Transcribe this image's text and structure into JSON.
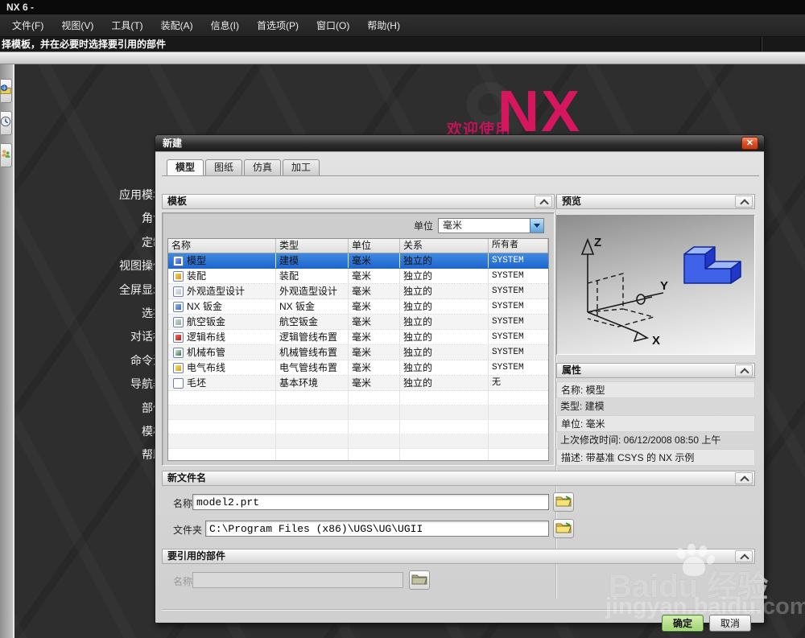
{
  "window": {
    "title": "NX 6 -",
    "prompt": "择模板，并在必要时选择要引用的部件"
  },
  "menubar": {
    "items": [
      "文件(F)",
      "视图(V)",
      "工具(T)",
      "装配(A)",
      "信息(I)",
      "首选项(P)",
      "窗口(O)",
      "帮助(H)"
    ]
  },
  "welcome": {
    "small_text": "欢迎使用",
    "big_text": "NX",
    "accent_color": "#d6175f"
  },
  "sidebar": {
    "items": [
      "应用模块",
      "角色",
      "定制",
      "视图操作",
      "全屏显示",
      "选择",
      "对话框",
      "命令流",
      "导航器",
      "部件",
      "模板",
      "帮助"
    ]
  },
  "resource_bar": {
    "icons": [
      "history-palette-icon",
      "clock-icon",
      "roles-icon"
    ]
  },
  "dialog": {
    "title": "新建",
    "close_label": "✕",
    "tabs": [
      "模型",
      "图纸",
      "仿真",
      "加工"
    ],
    "active_tab": "模型",
    "template_section": {
      "title": "模板",
      "units_label": "单位",
      "units_value": "毫米"
    },
    "table": {
      "headers": [
        "名称",
        "类型",
        "单位",
        "关系",
        "所有者"
      ],
      "rows": [
        {
          "name": "模型",
          "type": "建模",
          "units": "毫米",
          "relationship": "独立的",
          "owner": "SYSTEM",
          "selected": true,
          "icon": "model-icon"
        },
        {
          "name": "装配",
          "type": "装配",
          "units": "毫米",
          "relationship": "独立的",
          "owner": "SYSTEM",
          "selected": false,
          "icon": "assembly-icon"
        },
        {
          "name": "外观造型设计",
          "type": "外观造型设计",
          "units": "毫米",
          "relationship": "独立的",
          "owner": "SYSTEM",
          "selected": false,
          "icon": "shape-studio-icon"
        },
        {
          "name": "NX 钣金",
          "type": "NX 钣金",
          "units": "毫米",
          "relationship": "独立的",
          "owner": "SYSTEM",
          "selected": false,
          "icon": "sheet-metal-icon"
        },
        {
          "name": "航空钣金",
          "type": "航空钣金",
          "units": "毫米",
          "relationship": "独立的",
          "owner": "SYSTEM",
          "selected": false,
          "icon": "aero-sheet-metal-icon"
        },
        {
          "name": "逻辑布线",
          "type": "逻辑管线布置",
          "units": "毫米",
          "relationship": "独立的",
          "owner": "SYSTEM",
          "selected": false,
          "icon": "logical-routing-icon"
        },
        {
          "name": "机械布管",
          "type": "机械管线布置",
          "units": "毫米",
          "relationship": "独立的",
          "owner": "SYSTEM",
          "selected": false,
          "icon": "mechanical-routing-icon"
        },
        {
          "name": "电气布线",
          "type": "电气管线布置",
          "units": "毫米",
          "relationship": "独立的",
          "owner": "SYSTEM",
          "selected": false,
          "icon": "electrical-routing-icon"
        },
        {
          "name": "毛坯",
          "type": "基本环境",
          "units": "毫米",
          "relationship": "独立的",
          "owner": "无",
          "selected": false,
          "icon": "blank-icon"
        }
      ]
    },
    "preview_section": {
      "title": "预览",
      "axis_labels": {
        "x": "X",
        "y": "Y",
        "z": "Z"
      }
    },
    "properties_section": {
      "title": "属性",
      "rows": [
        "名称: 模型",
        "类型: 建模",
        "单位: 毫米",
        "上次修改时间: 06/12/2008 08:50 上午",
        "描述: 带基准 CSYS 的 NX 示例"
      ]
    },
    "new_file_section": {
      "title": "新文件名",
      "name_label": "名称",
      "name_value": "model2.prt",
      "folder_label": "文件夹",
      "folder_value": "C:\\Program Files (x86)\\UGS\\UG\\UGII"
    },
    "reference_section": {
      "title": "要引用的部件",
      "name_label": "名称",
      "name_value": ""
    },
    "buttons": {
      "ok": "确定",
      "cancel": "取消"
    }
  },
  "watermark": {
    "brand_left": "Bai",
    "brand_right": "du",
    "brand_suffix": "经验",
    "url": "jingyan.baidu.com"
  }
}
